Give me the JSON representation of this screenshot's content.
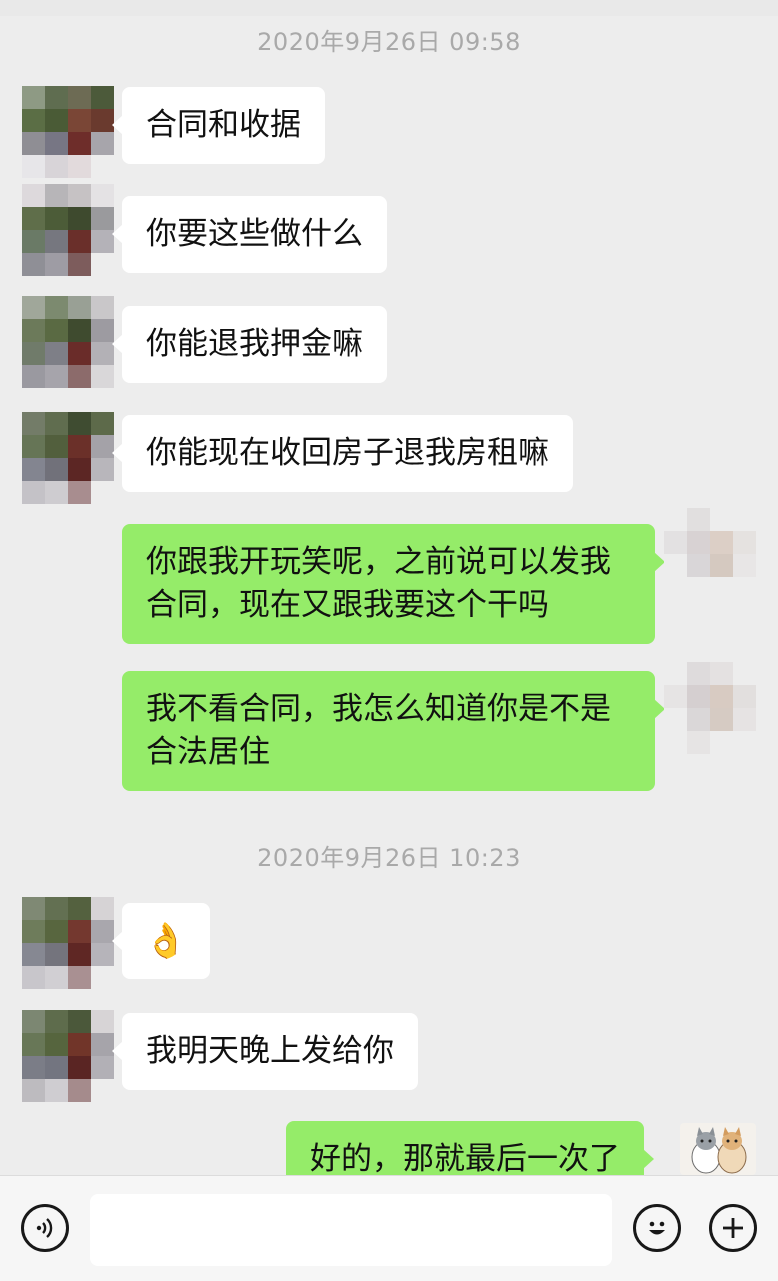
{
  "timestamps": [
    "2020年9月26日 09:58",
    "2020年9月26日 10:23"
  ],
  "messages": [
    {
      "side": "left",
      "text": "合同和收据"
    },
    {
      "side": "left",
      "text": "你要这些做什么"
    },
    {
      "side": "left",
      "text": "你能退我押金嘛"
    },
    {
      "side": "left",
      "text": "你能现在收回房子退我房租嘛"
    },
    {
      "side": "right",
      "line1": "你跟我开玩笑呢，之前说可以发我",
      "line2": "合同，现在又跟我要这个干吗"
    },
    {
      "side": "right",
      "line1": "我不看合同，我怎么知道你是不是",
      "line2": "合法居住"
    },
    {
      "side": "left",
      "text": "👌"
    },
    {
      "side": "left",
      "text": "我明天晚上发给你"
    },
    {
      "side": "right",
      "text": "好的，那就最后一次了"
    }
  ],
  "composer": {
    "input_value": "",
    "icons": [
      "voice-icon",
      "emoji-icon",
      "plus-icon"
    ]
  },
  "colors": {
    "background": "#ededed",
    "incoming_bubble": "#ffffff",
    "outgoing_bubble": "#95ec69",
    "timestamp_text": "#a9a9a9"
  }
}
